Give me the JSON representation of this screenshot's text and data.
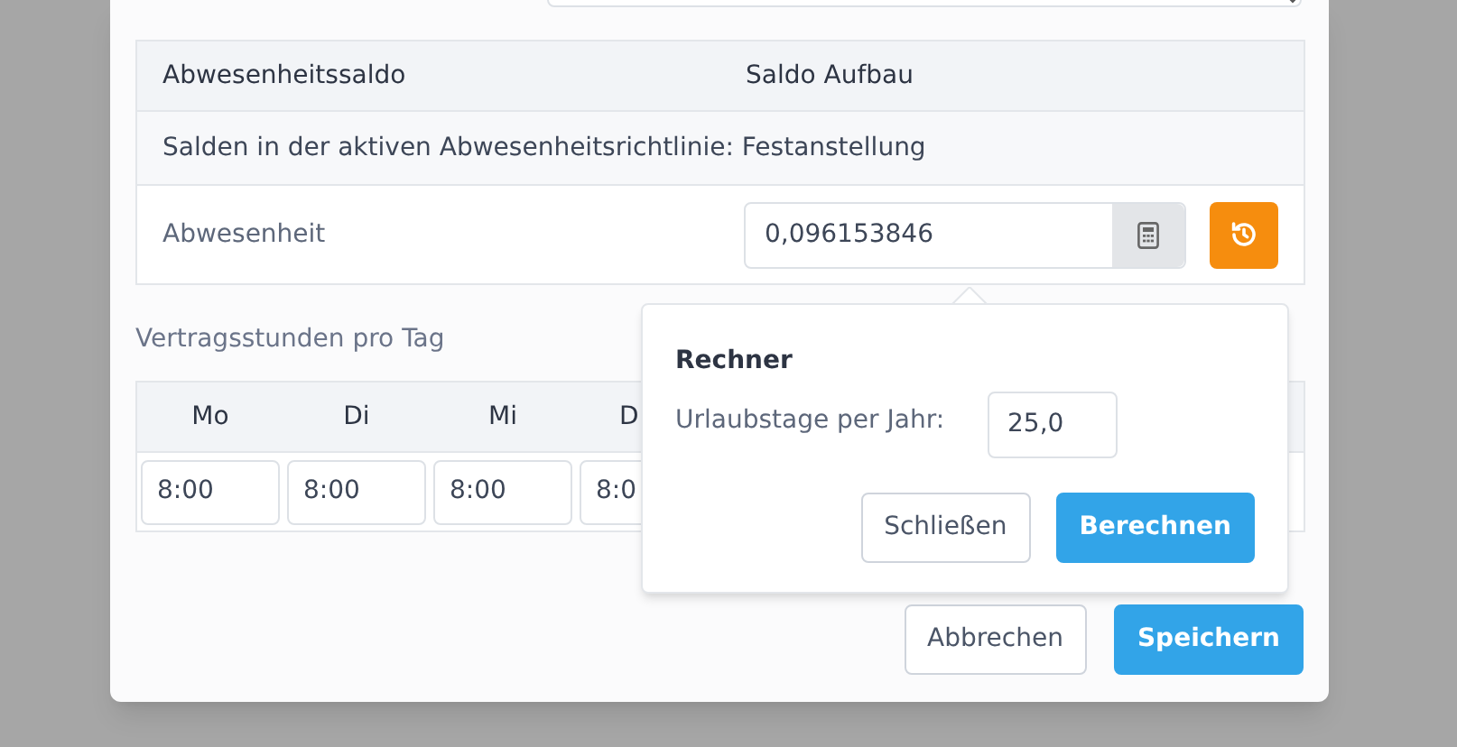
{
  "balance_table": {
    "columns": [
      "Abwesenheitssaldo",
      "Saldo Aufbau"
    ],
    "section": "Salden in der aktiven Abwesenheitsrichtlinie: Festanstellung",
    "rows": [
      {
        "label": "Abwesenheit",
        "value": "0,096153846"
      }
    ]
  },
  "hours": {
    "title": "Vertragsstunden pro Tag",
    "days": [
      {
        "day": "Mo",
        "value": "8:00"
      },
      {
        "day": "Di",
        "value": "8:00"
      },
      {
        "day": "Mi",
        "value": "8:00"
      },
      {
        "day": "D",
        "value": "8:0"
      }
    ]
  },
  "calculator": {
    "title": "Rechner",
    "label": "Urlaubstage per Jahr:",
    "value": "25,0",
    "buttons": [
      {
        "label": "Schließen",
        "kind": "secondary"
      },
      {
        "label": "Berechnen",
        "kind": "primary"
      }
    ]
  },
  "footer_buttons": [
    {
      "label": "Abbrechen",
      "kind": "secondary"
    },
    {
      "label": "Speichern",
      "kind": "primary"
    }
  ]
}
